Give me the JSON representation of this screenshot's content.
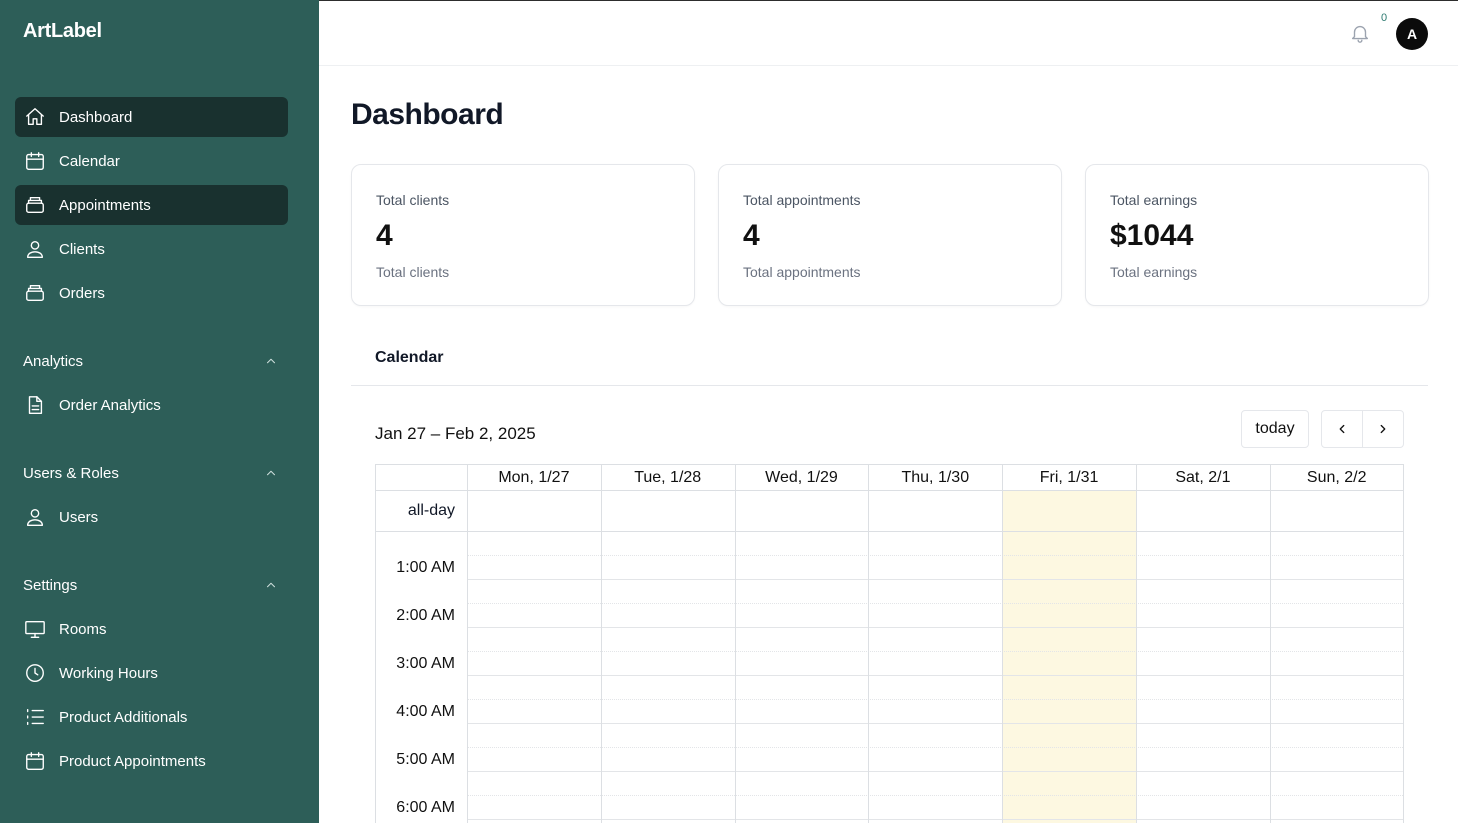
{
  "brand": "ArtLabel",
  "sidebar": {
    "items": [
      {
        "label": "Dashboard",
        "icon": "home-icon"
      },
      {
        "label": "Calendar",
        "icon": "calendar-icon"
      },
      {
        "label": "Appointments",
        "icon": "stack-icon"
      },
      {
        "label": "Clients",
        "icon": "user-icon"
      },
      {
        "label": "Orders",
        "icon": "stack-icon"
      }
    ],
    "sections": [
      {
        "title": "Analytics",
        "items": [
          {
            "label": "Order Analytics",
            "icon": "document-icon"
          }
        ]
      },
      {
        "title": "Users & Roles",
        "items": [
          {
            "label": "Users",
            "icon": "user-icon"
          }
        ]
      },
      {
        "title": "Settings",
        "items": [
          {
            "label": "Rooms",
            "icon": "monitor-icon"
          },
          {
            "label": "Working Hours",
            "icon": "clock-icon"
          },
          {
            "label": "Product Additionals",
            "icon": "list-icon"
          },
          {
            "label": "Product Appointments",
            "icon": "calendar-icon"
          }
        ]
      }
    ]
  },
  "topbar": {
    "notification_count": "0",
    "avatar_initial": "A"
  },
  "main": {
    "title": "Dashboard",
    "cards": [
      {
        "title": "Total clients",
        "value": "4",
        "subtitle": "Total clients"
      },
      {
        "title": "Total appointments",
        "value": "4",
        "subtitle": "Total appointments"
      },
      {
        "title": "Total earnings",
        "value": "$1044",
        "subtitle": "Total earnings"
      }
    ]
  },
  "calendar": {
    "heading": "Calendar",
    "range": "Jan 27 – Feb 2, 2025",
    "today_label": "today",
    "days": [
      "Mon, 1/27",
      "Tue, 1/28",
      "Wed, 1/29",
      "Thu, 1/30",
      "Fri, 1/31",
      "Sat, 2/1",
      "Sun, 2/2"
    ],
    "today_index": 4,
    "allday_label": "all-day",
    "times": [
      "1:00 AM",
      "2:00 AM",
      "3:00 AM",
      "4:00 AM",
      "5:00 AM",
      "6:00 AM"
    ]
  },
  "colors": {
    "sidebar_bg": "#2d5e58",
    "sidebar_active": "#19312f",
    "today_highlight": "#fdf8e1"
  }
}
